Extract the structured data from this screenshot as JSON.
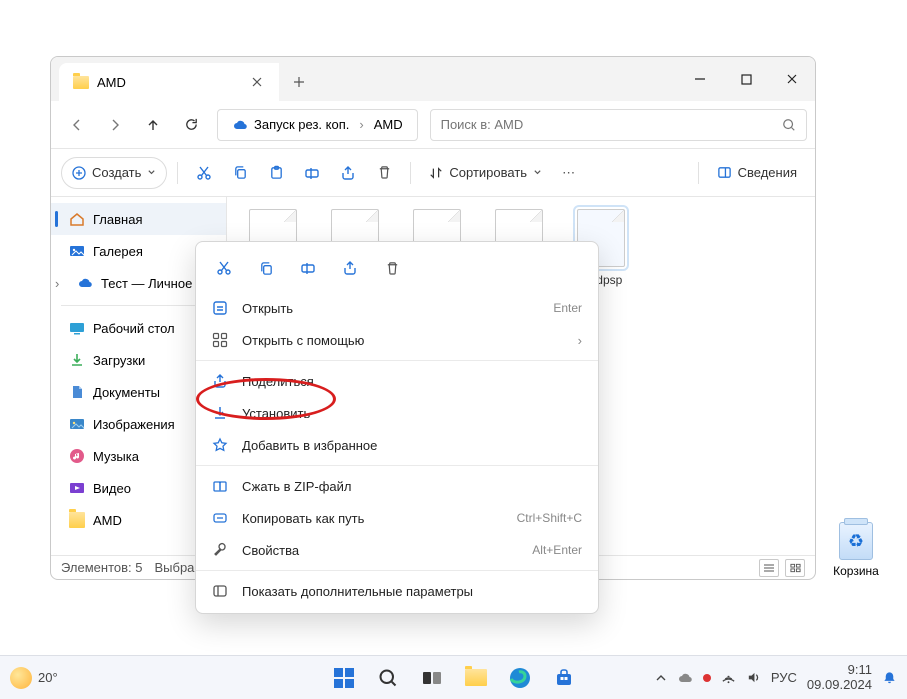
{
  "window": {
    "tab_title": "AMD",
    "breadcrumb": {
      "root": "Запуск рез. коп.",
      "current": "AMD"
    },
    "search_placeholder": "Поиск в: AMD"
  },
  "toolbar": {
    "create": "Создать",
    "sort": "Сортировать",
    "details": "Сведения"
  },
  "sidebar": {
    "home": "Главная",
    "gallery": "Галерея",
    "personal": "Тест — Личное",
    "desktop": "Рабочий стол",
    "downloads": "Загрузки",
    "documents": "Документы",
    "pictures": "Изображения",
    "music": "Музыка",
    "videos": "Видео",
    "amd": "AMD"
  },
  "files": {
    "f5_name": "amdpsp"
  },
  "statusbar": {
    "count": "Элементов: 5",
    "selected": "Выбра"
  },
  "context_menu": {
    "open": "Открыть",
    "open_shortcut": "Enter",
    "open_with": "Открыть с помощью",
    "share": "Поделиться",
    "install": "Установить",
    "favorite": "Добавить в избранное",
    "zip": "Сжать в ZIP-файл",
    "copy_path": "Копировать как путь",
    "copy_path_shortcut": "Ctrl+Shift+C",
    "properties": "Свойства",
    "properties_shortcut": "Alt+Enter",
    "more": "Показать дополнительные параметры"
  },
  "desktop_icons": {
    "recycle": "Корзина"
  },
  "taskbar": {
    "temp": "20°",
    "lang": "РУС",
    "time": "9:11",
    "date": "09.09.2024"
  }
}
